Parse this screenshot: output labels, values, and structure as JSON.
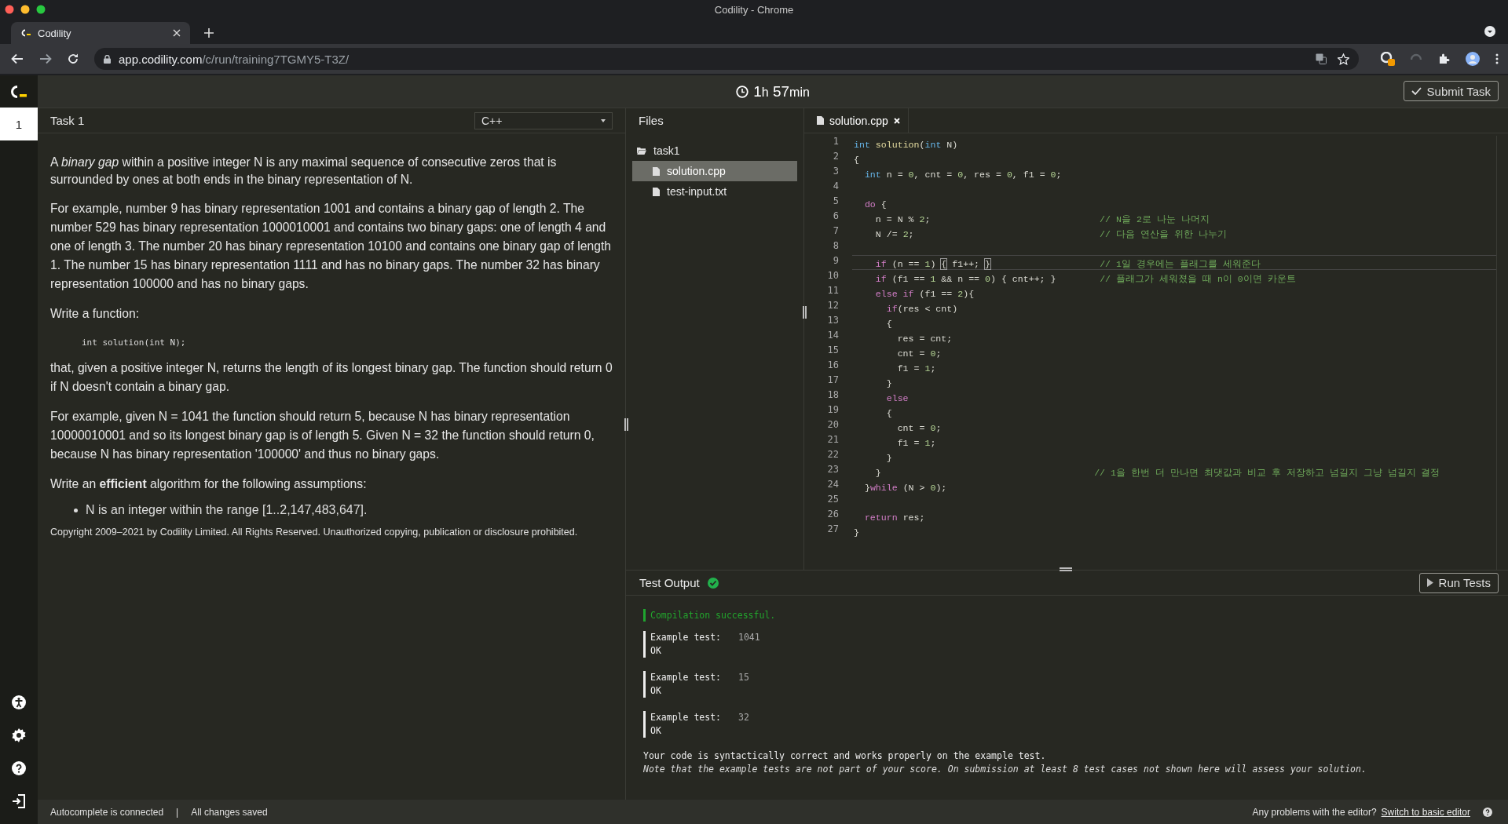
{
  "browser": {
    "window_title": "Codility - Chrome",
    "tab": {
      "title": "Codility"
    },
    "url": {
      "host": "app.codility.com",
      "path": "/c/run/training7TGMY5-T3Z/"
    }
  },
  "header": {
    "timer": [
      {
        "value": "1",
        "unit": "h"
      },
      {
        "value": "57",
        "unit": "min"
      }
    ],
    "submit_button": "Submit Task"
  },
  "sidebar": {
    "tasks": [
      {
        "label": "1",
        "selected": true
      }
    ]
  },
  "task_panel": {
    "title": "Task 1",
    "language": "C++",
    "blocks": [
      {
        "kind": "paragraph",
        "text": "A *binary gap* within a positive integer N is any maximal sequence of consecutive zeros that is surrounded by ones at both ends in the binary representation of N."
      },
      {
        "kind": "paragraph",
        "text": "For example, number 9 has binary representation 1001 and contains a binary gap of length 2. The number 529 has binary representation 1000010001 and contains two binary gaps: one of length 4 and one of length 3. The number 20 has binary representation 10100 and contains one binary gap of length 1. The number 15 has binary representation 1111 and has no binary gaps. The number 32 has binary representation 100000 and has no binary gaps."
      },
      {
        "kind": "paragraph",
        "text": "Write a function:"
      },
      {
        "kind": "code",
        "text": "int solution(int N);"
      },
      {
        "kind": "paragraph",
        "text": "that, given a positive integer N, returns the length of its longest binary gap. The function should return 0 if N doesn't contain a binary gap."
      },
      {
        "kind": "paragraph",
        "text": "For example, given N = 1041 the function should return 5, because N has binary representation 10000010001 and so its longest binary gap is of length 5. Given N = 32 the function should return 0, because N has binary representation '100000' and thus no binary gaps."
      },
      {
        "kind": "paragraph",
        "text": "Write an **efficient** algorithm for the following assumptions:"
      },
      {
        "kind": "bullets",
        "items": [
          "N is an integer within the range [1..2,147,483,647]."
        ]
      },
      {
        "kind": "copyright",
        "text": "Copyright 2009–2021 by Codility Limited. All Rights Reserved. Unauthorized copying, publication or disclosure prohibited."
      }
    ]
  },
  "files": {
    "title": "Files",
    "tree": [
      {
        "name": "task1",
        "kind": "folder",
        "expanded": true,
        "selected": false,
        "children": [
          {
            "name": "solution.cpp",
            "kind": "file",
            "selected": true
          },
          {
            "name": "test-input.txt",
            "kind": "file",
            "selected": false
          }
        ]
      }
    ]
  },
  "editor": {
    "tabs": [
      {
        "label": "solution.cpp",
        "selected": true
      }
    ],
    "lines": [
      {
        "number": "1",
        "current": false,
        "tokens": [
          {
            "kind": "type",
            "text": "int "
          },
          {
            "kind": "function",
            "text": "solution"
          },
          {
            "kind": "plain",
            "text": "("
          },
          {
            "kind": "type",
            "text": "int"
          },
          {
            "kind": "plain",
            "text": " N)"
          }
        ]
      },
      {
        "number": "2",
        "current": false,
        "tokens": [
          {
            "kind": "plain",
            "text": "{"
          }
        ]
      },
      {
        "number": "3",
        "current": false,
        "tokens": [
          {
            "kind": "type",
            "text": "  int"
          },
          {
            "kind": "plain",
            "text": " n = "
          },
          {
            "kind": "number",
            "text": "0"
          },
          {
            "kind": "plain",
            "text": ", cnt = "
          },
          {
            "kind": "number",
            "text": "0"
          },
          {
            "kind": "plain",
            "text": ", res = "
          },
          {
            "kind": "number",
            "text": "0"
          },
          {
            "kind": "plain",
            "text": ", f1 = "
          },
          {
            "kind": "number",
            "text": "0"
          },
          {
            "kind": "plain",
            "text": ";"
          }
        ]
      },
      {
        "number": "4",
        "current": false
      },
      {
        "number": "5",
        "current": false,
        "tokens": [
          {
            "kind": "control",
            "text": "  do"
          },
          {
            "kind": "plain",
            "text": " {"
          }
        ]
      },
      {
        "number": "6",
        "current": false,
        "tokens": [
          {
            "kind": "plain",
            "text": "    n = N % "
          },
          {
            "kind": "number",
            "text": "2"
          },
          {
            "kind": "plain",
            "text": ";"
          },
          {
            "kind": "comment",
            "text": "                               // N을 2로 나눈 나머지"
          }
        ]
      },
      {
        "number": "7",
        "current": false,
        "tokens": [
          {
            "kind": "plain",
            "text": "    N /= "
          },
          {
            "kind": "number",
            "text": "2"
          },
          {
            "kind": "plain",
            "text": ";"
          },
          {
            "kind": "comment",
            "text": "                                  // 다음 연산을 위한 나누기"
          }
        ]
      },
      {
        "number": "8",
        "current": false
      },
      {
        "number": "9",
        "current": true,
        "tokens": [
          {
            "kind": "control",
            "text": "    if"
          },
          {
            "kind": "plain",
            "text": " (n == "
          },
          {
            "kind": "number",
            "text": "1"
          },
          {
            "kind": "plain",
            "text": ") "
          },
          {
            "kind": "bracket",
            "text": "{"
          },
          {
            "kind": "plain",
            "text": " f1++; "
          },
          {
            "kind": "bracket",
            "text": "}"
          },
          {
            "kind": "comment",
            "text": "                    // 1일 경우에는 플래그를 세워준다"
          }
        ]
      },
      {
        "number": "10",
        "current": false,
        "tokens": [
          {
            "kind": "control",
            "text": "    if"
          },
          {
            "kind": "plain",
            "text": " (f1 == "
          },
          {
            "kind": "number",
            "text": "1"
          },
          {
            "kind": "plain",
            "text": " && n == "
          },
          {
            "kind": "number",
            "text": "0"
          },
          {
            "kind": "plain",
            "text": ") { cnt++; }"
          },
          {
            "kind": "comment",
            "text": "        // 플래그가 세워졌을 때 n이 0이면 카운트"
          }
        ]
      },
      {
        "number": "11",
        "current": false,
        "tokens": [
          {
            "kind": "control",
            "text": "    else if"
          },
          {
            "kind": "plain",
            "text": " (f1 == "
          },
          {
            "kind": "number",
            "text": "2"
          },
          {
            "kind": "plain",
            "text": "){"
          }
        ]
      },
      {
        "number": "12",
        "current": false,
        "tokens": [
          {
            "kind": "control",
            "text": "      if"
          },
          {
            "kind": "plain",
            "text": "(res < cnt)"
          }
        ]
      },
      {
        "number": "13",
        "current": false,
        "tokens": [
          {
            "kind": "plain",
            "text": "      {"
          }
        ]
      },
      {
        "number": "14",
        "current": false,
        "tokens": [
          {
            "kind": "plain",
            "text": "        res = cnt;"
          }
        ]
      },
      {
        "number": "15",
        "current": false,
        "tokens": [
          {
            "kind": "plain",
            "text": "        cnt = "
          },
          {
            "kind": "number",
            "text": "0"
          },
          {
            "kind": "plain",
            "text": ";"
          }
        ]
      },
      {
        "number": "16",
        "current": false,
        "tokens": [
          {
            "kind": "plain",
            "text": "        f1 = "
          },
          {
            "kind": "number",
            "text": "1"
          },
          {
            "kind": "plain",
            "text": ";"
          }
        ]
      },
      {
        "number": "17",
        "current": false,
        "tokens": [
          {
            "kind": "plain",
            "text": "      }"
          }
        ]
      },
      {
        "number": "18",
        "current": false,
        "tokens": [
          {
            "kind": "control",
            "text": "      else"
          }
        ]
      },
      {
        "number": "19",
        "current": false,
        "tokens": [
          {
            "kind": "plain",
            "text": "      {"
          }
        ]
      },
      {
        "number": "20",
        "current": false,
        "tokens": [
          {
            "kind": "plain",
            "text": "        cnt = "
          },
          {
            "kind": "number",
            "text": "0"
          },
          {
            "kind": "plain",
            "text": ";"
          }
        ]
      },
      {
        "number": "21",
        "current": false,
        "tokens": [
          {
            "kind": "plain",
            "text": "        f1 = "
          },
          {
            "kind": "number",
            "text": "1"
          },
          {
            "kind": "plain",
            "text": ";"
          }
        ]
      },
      {
        "number": "22",
        "current": false,
        "tokens": [
          {
            "kind": "plain",
            "text": "      }"
          }
        ]
      },
      {
        "number": "23",
        "current": false,
        "tokens": [
          {
            "kind": "plain",
            "text": "    }"
          },
          {
            "kind": "comment",
            "text": "                                       // 1을 한번 더 만나면 최댓값과 비교 후 저장하고 넘길지 그냥 넘길지 결정"
          }
        ]
      },
      {
        "number": "24",
        "current": false,
        "tokens": [
          {
            "kind": "plain",
            "text": "  }"
          },
          {
            "kind": "control",
            "text": "while"
          },
          {
            "kind": "plain",
            "text": " (N > "
          },
          {
            "kind": "number",
            "text": "0"
          },
          {
            "kind": "plain",
            "text": ");"
          }
        ]
      },
      {
        "number": "25",
        "current": false
      },
      {
        "number": "26",
        "current": false,
        "tokens": [
          {
            "kind": "control",
            "text": "  return"
          },
          {
            "kind": "plain",
            "text": " res;"
          }
        ]
      },
      {
        "number": "27",
        "current": false,
        "tokens": [
          {
            "kind": "plain",
            "text": "}"
          }
        ]
      }
    ]
  },
  "test_output": {
    "title": "Test Output",
    "passed": true,
    "run_button": "Run Tests",
    "compilation": "Compilation successful.",
    "tests": [
      {
        "label": "Example test:",
        "input": "1041",
        "result": "OK"
      },
      {
        "label": "Example test:",
        "input": "15",
        "result": "OK"
      },
      {
        "label": "Example test:",
        "input": "32",
        "result": "OK"
      }
    ],
    "summary": "Your code is syntactically correct and works properly on the example test.",
    "note": "Note that the example tests are not part of your score. On submission at least 8 test cases not shown here will assess your solution."
  },
  "status_bar": {
    "left": [
      "Autocomplete is connected",
      "|",
      "All changes saved"
    ],
    "question": "Any problems with the editor?",
    "link": "Switch to basic editor"
  }
}
